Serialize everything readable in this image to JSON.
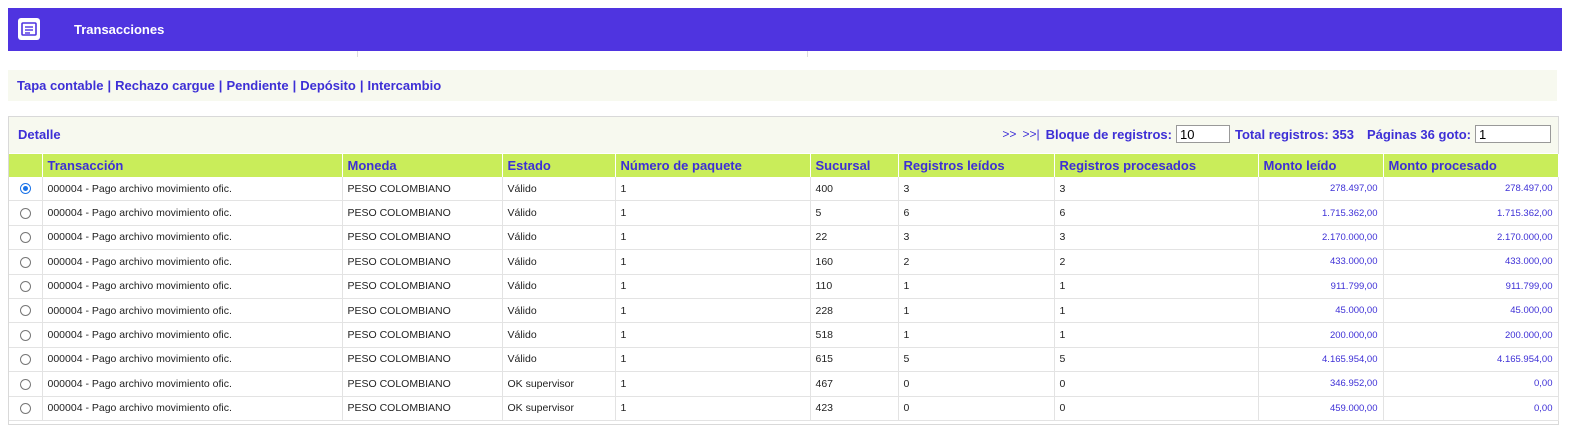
{
  "header": {
    "title": "Transacciones",
    "icon": "document-list-icon"
  },
  "links": [
    "Tapa contable",
    "Rechazo cargue",
    "Pendiente",
    "Depósito",
    "Intercambio"
  ],
  "panel": {
    "title": "Detalle",
    "nav_next": ">>",
    "nav_last": ">>|",
    "block_label": "Bloque de registros:",
    "block_value": "10",
    "total_label": "Total registros: 353",
    "pages_label": "Páginas 36 goto:",
    "goto_value": "1"
  },
  "table": {
    "columns": [
      "",
      "Transacción",
      "Moneda",
      "Estado",
      "Número de paquete",
      "Sucursal",
      "Registros leídos",
      "Registros procesados",
      "Monto leído",
      "Monto procesado"
    ],
    "rows": [
      {
        "selected": true,
        "cells": [
          "000004 - Pago archivo movimiento ofic.",
          "PESO COLOMBIANO",
          "Válido",
          "1",
          "400",
          "3",
          "3",
          "278.497,00",
          "278.497,00"
        ]
      },
      {
        "selected": false,
        "cells": [
          "000004 - Pago archivo movimiento ofic.",
          "PESO COLOMBIANO",
          "Válido",
          "1",
          "5",
          "6",
          "6",
          "1.715.362,00",
          "1.715.362,00"
        ]
      },
      {
        "selected": false,
        "cells": [
          "000004 - Pago archivo movimiento ofic.",
          "PESO COLOMBIANO",
          "Válido",
          "1",
          "22",
          "3",
          "3",
          "2.170.000,00",
          "2.170.000,00"
        ]
      },
      {
        "selected": false,
        "cells": [
          "000004 - Pago archivo movimiento ofic.",
          "PESO COLOMBIANO",
          "Válido",
          "1",
          "160",
          "2",
          "2",
          "433.000,00",
          "433.000,00"
        ]
      },
      {
        "selected": false,
        "cells": [
          "000004 - Pago archivo movimiento ofic.",
          "PESO COLOMBIANO",
          "Válido",
          "1",
          "110",
          "1",
          "1",
          "911.799,00",
          "911.799,00"
        ]
      },
      {
        "selected": false,
        "cells": [
          "000004 - Pago archivo movimiento ofic.",
          "PESO COLOMBIANO",
          "Válido",
          "1",
          "228",
          "1",
          "1",
          "45.000,00",
          "45.000,00"
        ]
      },
      {
        "selected": false,
        "cells": [
          "000004 - Pago archivo movimiento ofic.",
          "PESO COLOMBIANO",
          "Válido",
          "1",
          "518",
          "1",
          "1",
          "200.000,00",
          "200.000,00"
        ]
      },
      {
        "selected": false,
        "cells": [
          "000004 - Pago archivo movimiento ofic.",
          "PESO COLOMBIANO",
          "Válido",
          "1",
          "615",
          "5",
          "5",
          "4.165.954,00",
          "4.165.954,00"
        ]
      },
      {
        "selected": false,
        "cells": [
          "000004 - Pago archivo movimiento ofic.",
          "PESO COLOMBIANO",
          "OK supervisor",
          "1",
          "467",
          "0",
          "0",
          "346.952,00",
          "0,00"
        ]
      },
      {
        "selected": false,
        "cells": [
          "000004 - Pago archivo movimiento ofic.",
          "PESO COLOMBIANO",
          "OK supervisor",
          "1",
          "423",
          "0",
          "0",
          "459.000,00",
          "0,00"
        ]
      }
    ]
  },
  "colors": {
    "header_bg": "#4f34e0",
    "accent_text": "#3d2fd6",
    "table_header_bg": "#c9ed5a",
    "bar_bg": "#f7f9ef"
  }
}
